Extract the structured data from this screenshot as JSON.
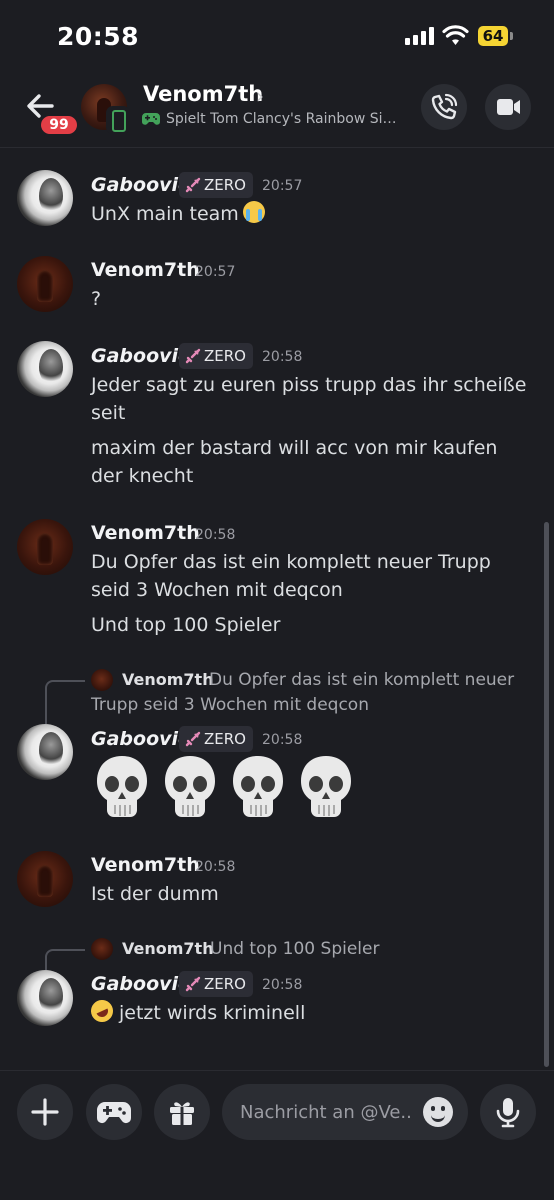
{
  "status_bar": {
    "time": "20:58",
    "battery": "64"
  },
  "header": {
    "unread_badge": "99",
    "name": "Venom7th",
    "activity": "Spielt Tom Clancy's Rainbow Six®..."
  },
  "messages": [
    {
      "author": "Gaboovic",
      "tag": "ZERO",
      "time": "20:57",
      "lines": [
        "UnX main team"
      ]
    },
    {
      "author": "Venom7th",
      "time": "20:57",
      "lines": [
        "?"
      ]
    },
    {
      "author": "Gaboovic",
      "tag": "ZERO",
      "time": "20:58",
      "lines": [
        "Jeder sagt zu euren piss trupp das ihr scheiße seit",
        "maxim der bastard will acc von mir kaufen der knecht"
      ]
    },
    {
      "author": "Venom7th",
      "time": "20:58",
      "lines": [
        "Du Opfer das ist ein komplett neuer Trupp seid 3 Wochen mit deqcon",
        "Und top 100 Spieler"
      ]
    },
    {
      "reply": {
        "author": "Venom7th",
        "text": "Du Opfer das ist ein komplett neuer Trupp seid 3 Wochen mit deqcon"
      },
      "author": "Gaboovic",
      "tag": "ZERO",
      "time": "20:58",
      "content": "skull-emoji x4"
    },
    {
      "author": "Venom7th",
      "time": "20:58",
      "lines": [
        "Ist der dumm"
      ]
    },
    {
      "reply": {
        "author": "Venom7th",
        "text": "Und top 100 Spieler"
      },
      "author": "Gaboovic",
      "tag": "ZERO",
      "time": "20:58",
      "lines": [
        "jetzt wirds kriminell"
      ]
    }
  ],
  "composer": {
    "placeholder": "Nachricht an @Ve.."
  },
  "icons": [
    "back-arrow-icon",
    "phone-icon",
    "video-camera-icon",
    "gamepad-icon",
    "sword-icon",
    "plus-icon",
    "gift-icon",
    "emoji-icon",
    "microphone-icon",
    "skull-icon"
  ],
  "colors": {
    "background": "#1c1d22",
    "notification_red": "#e33e46",
    "online_green": "#43a25a",
    "battery_yellow": "#f5d433"
  }
}
